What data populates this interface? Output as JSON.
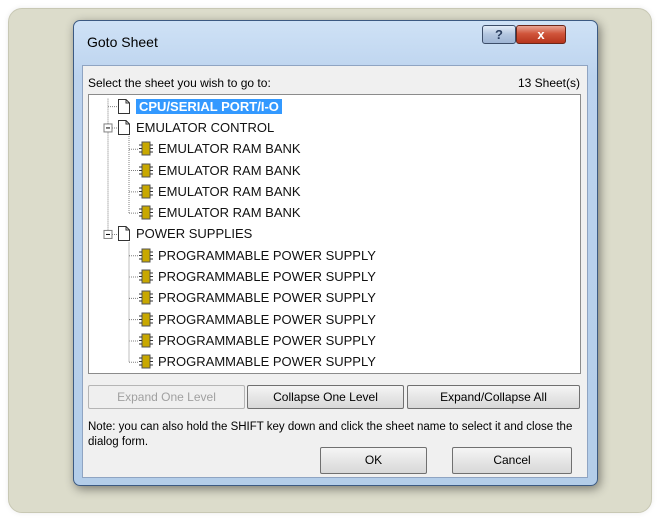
{
  "dialog": {
    "title": "Goto Sheet",
    "help_label": "?",
    "close_label": "x"
  },
  "prompt": "Select the sheet you wish to go to:",
  "sheet_count": "13 Sheet(s)",
  "tree": {
    "items": [
      {
        "label": "CPU/SERIAL PORT/I-O",
        "type": "sheet",
        "level": 0,
        "selected": true
      },
      {
        "label": "EMULATOR CONTROL",
        "type": "sheet",
        "level": 0,
        "expanded": true
      },
      {
        "label": "EMULATOR RAM BANK",
        "type": "component",
        "level": 1
      },
      {
        "label": "EMULATOR RAM BANK",
        "type": "component",
        "level": 1
      },
      {
        "label": "EMULATOR RAM BANK",
        "type": "component",
        "level": 1
      },
      {
        "label": "EMULATOR RAM BANK",
        "type": "component",
        "level": 1
      },
      {
        "label": "POWER SUPPLIES",
        "type": "sheet",
        "level": 0,
        "expanded": true
      },
      {
        "label": "PROGRAMMABLE POWER SUPPLY",
        "type": "component",
        "level": 1
      },
      {
        "label": "PROGRAMMABLE POWER SUPPLY",
        "type": "component",
        "level": 1
      },
      {
        "label": "PROGRAMMABLE POWER SUPPLY",
        "type": "component",
        "level": 1
      },
      {
        "label": "PROGRAMMABLE POWER SUPPLY",
        "type": "component",
        "level": 1
      },
      {
        "label": "PROGRAMMABLE POWER SUPPLY",
        "type": "component",
        "level": 1
      },
      {
        "label": "PROGRAMMABLE POWER SUPPLY",
        "type": "component",
        "level": 1
      }
    ]
  },
  "buttons": {
    "expand_one": "Expand One Level",
    "collapse_one": "Collapse One Level",
    "expand_collapse_all": "Expand/Collapse All",
    "ok": "OK",
    "cancel": "Cancel"
  },
  "note": "Note: you can also hold the SHIFT key down and click the sheet name to select it and close the dialog form.",
  "colors": {
    "selection": "#3399ff",
    "component_icon": "#c8a800"
  }
}
